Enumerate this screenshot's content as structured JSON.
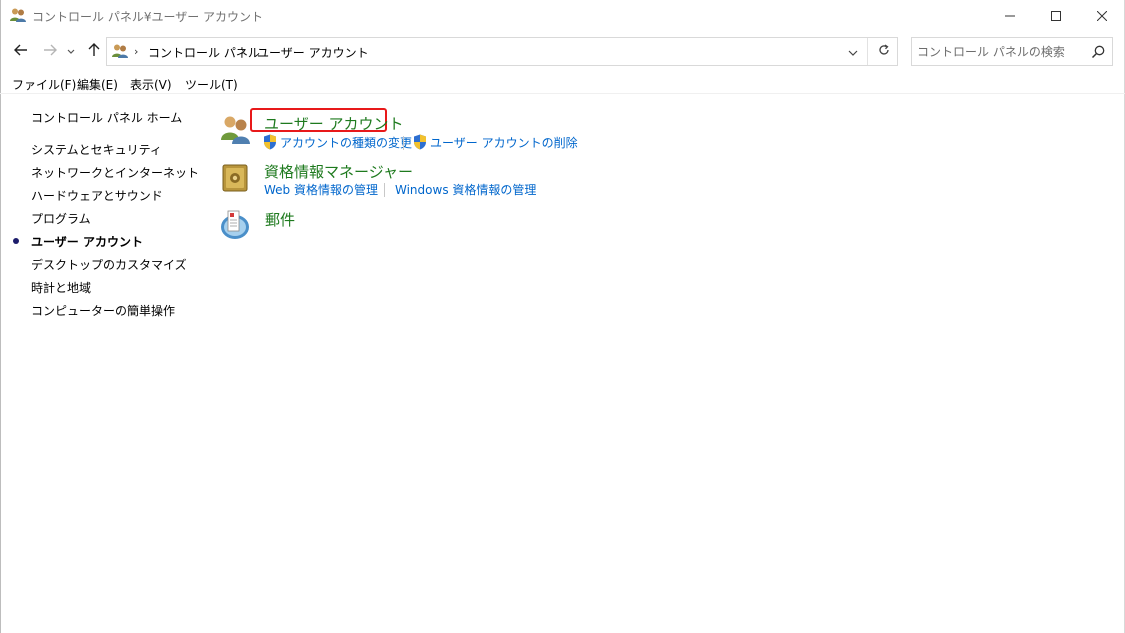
{
  "window": {
    "title": "コントロール パネル¥ユーザー アカウント",
    "minimize_icon": "minimize-icon",
    "maximize_icon": "maximize-icon",
    "close_icon": "close-icon"
  },
  "nav": {
    "breadcrumb": [
      "コントロール パネル",
      "ユーザー アカウント"
    ],
    "search_placeholder": "コントロール パネルの検索"
  },
  "menu": [
    "ファイル(F)",
    "編集(E)",
    "表示(V)",
    "ツール(T)"
  ],
  "sidebar": {
    "home": "コントロール パネル ホーム",
    "items": [
      {
        "label": "システムとセキュリティ"
      },
      {
        "label": "ネットワークとインターネット"
      },
      {
        "label": "ハードウェアとサウンド"
      },
      {
        "label": "プログラム"
      },
      {
        "label": "ユーザー アカウント",
        "active": true
      },
      {
        "label": "デスクトップのカスタマイズ"
      },
      {
        "label": "時計と地域"
      },
      {
        "label": "コンピューターの簡単操作"
      }
    ]
  },
  "categories": [
    {
      "title": "ユーザー アカウント",
      "icon": "users-icon",
      "links": [
        "アカウントの種類の変更",
        "ユーザー アカウントの削除"
      ]
    },
    {
      "title": "資格情報マネージャー",
      "icon": "vault-icon",
      "links": [
        "Web 資格情報の管理",
        "Windows 資格情報の管理"
      ]
    },
    {
      "title": "郵件",
      "icon": "mail-icon",
      "links": []
    }
  ],
  "colors": {
    "category_title": "#1e7a1e",
    "link": "#0066cc",
    "highlight_border": "#e8191a"
  }
}
